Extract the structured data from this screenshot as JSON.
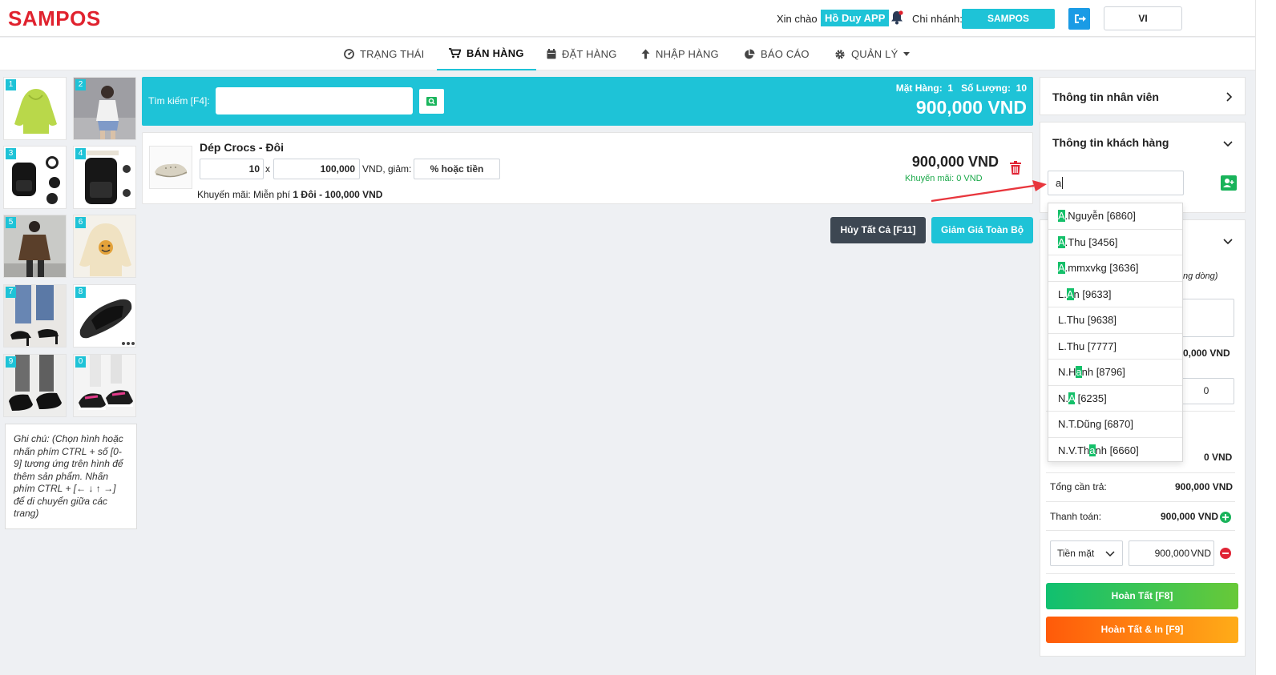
{
  "header": {
    "logo": "SAMPOS",
    "greeting": "Xin chào",
    "user": "Hồ Duy APP",
    "branch_label": "Chi nhánh:",
    "branch": "SAMPOS",
    "language": "VI"
  },
  "nav": [
    {
      "label": "TRẠNG THÁI",
      "icon": "dashboard-icon"
    },
    {
      "label": "BÁN HÀNG",
      "icon": "cart-icon"
    },
    {
      "label": "ĐẶT HÀNG",
      "icon": "calendar-icon"
    },
    {
      "label": "NHẬP HÀNG",
      "icon": "arrow-up-icon"
    },
    {
      "label": "BÁO CÁO",
      "icon": "pie-chart-icon"
    },
    {
      "label": "QUẢN LÝ",
      "icon": "gear-icon"
    }
  ],
  "products": [
    {
      "num": "1",
      "kind": "hoodie-green"
    },
    {
      "num": "2",
      "kind": "girl-photo"
    },
    {
      "num": "3",
      "kind": "backpack"
    },
    {
      "num": "4",
      "kind": "backpack-2"
    },
    {
      "num": "5",
      "kind": "jacket-brown"
    },
    {
      "num": "6",
      "kind": "hoodie-cream"
    },
    {
      "num": "7",
      "kind": "heels"
    },
    {
      "num": "8",
      "kind": "slide-sandal"
    },
    {
      "num": "9",
      "kind": "loafers"
    },
    {
      "num": "0",
      "kind": "sneakers"
    }
  ],
  "note": "Ghi chú: (Chọn hình hoặc nhấn phím CTRL + số [0-9] tương ứng trên hình để thêm sản phẩm. Nhấn phím CTRL + [← ↓ ↑ →] để di chuyển giữa các trang)",
  "search": {
    "label": "Tìm kiếm [F4]:",
    "value": "",
    "items_text": "Mặt Hàng:",
    "items_count": "1",
    "qty_text": "Số Lượng:",
    "qty_count": "10",
    "total": "900,000 VND"
  },
  "cart": {
    "name": "Dép Crocs - Đôi",
    "qty": "10",
    "times": "x",
    "price": "100,000",
    "discount_label": "VND, giảm:",
    "discount_placeholder": "% hoặc tiền",
    "promo_prefix": "Khuyến mãi: Miễn phí",
    "promo_bold": "1 Đôi - 100,000 VND",
    "line_total": "900,000 VND",
    "line_promo": "Khuyến mãi: 0 VND"
  },
  "buttons": {
    "cancel_all": "Hủy Tất Cả [F11]",
    "discount_all": "Giảm Giá Toàn Bộ",
    "finish": "Hoàn Tất [F8]",
    "finish_print": "Hoàn Tất & In [F9]"
  },
  "panel": {
    "staff_title": "Thông tin nhân viên",
    "customer_title": "Thông tin khách hàng",
    "customer_input": "a",
    "partial_note": "ng dòng)",
    "subtotal_partial": "0,000 VND",
    "box_value": "0",
    "zero_vnd": "0 VND",
    "total_label": "Tổng cần trả:",
    "total_value": "900,000 VND",
    "pay_label": "Thanh toán:",
    "pay_value": "900,000 VND",
    "method": "Tiền mặt",
    "method_amount": "900,000",
    "method_unit": "VND"
  },
  "customers": [
    {
      "pre": "",
      "hl": "A",
      "post": ".Nguyễn [6860]"
    },
    {
      "pre": "",
      "hl": "A",
      "post": ".Thu [3456]"
    },
    {
      "pre": "",
      "hl": "A",
      "post": ".mmxvkg [3636]"
    },
    {
      "pre": "L.",
      "hl": "A",
      "post": "n [9633]"
    },
    {
      "pre": "L.Thu [9638]",
      "hl": "",
      "post": ""
    },
    {
      "pre": "L.Thu [7777]",
      "hl": "",
      "post": ""
    },
    {
      "pre": "N.H",
      "hl": "a",
      "post": "nh [8796]"
    },
    {
      "pre": "N.",
      "hl": "A",
      "post": " [6235]"
    },
    {
      "pre": "N.T.Dũng [6870]",
      "hl": "",
      "post": ""
    },
    {
      "pre": "N.V.Th",
      "hl": "a",
      "post": "nh [6660]"
    }
  ],
  "colors": {
    "brand": "#e0222e",
    "accent": "#1ec3d7",
    "success": "#19b35a",
    "danger": "#e02435"
  }
}
